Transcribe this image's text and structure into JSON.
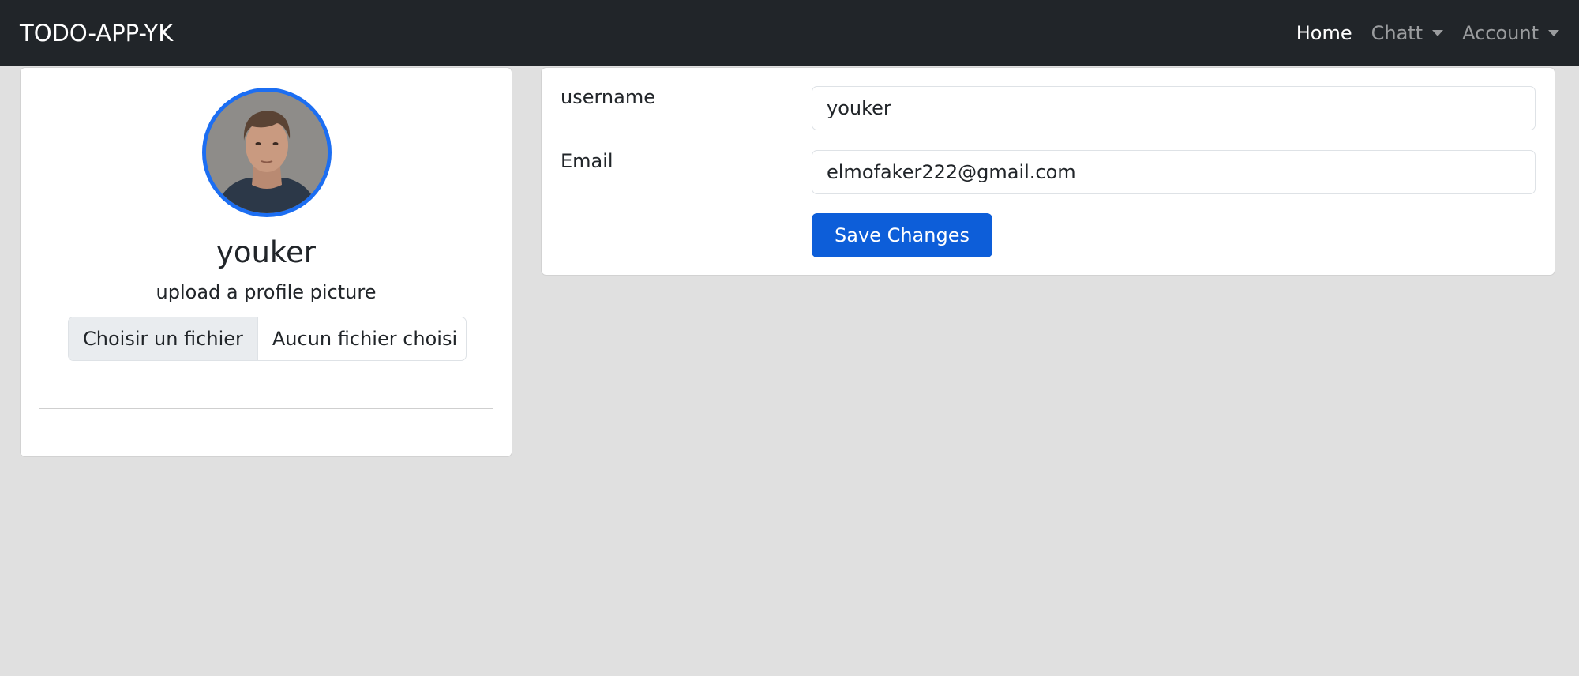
{
  "navbar": {
    "brand": "TODO-APP-YK",
    "links": [
      {
        "label": "Home",
        "active": true,
        "dropdown": false
      },
      {
        "label": "Chatt",
        "active": false,
        "dropdown": true
      },
      {
        "label": "Account",
        "active": false,
        "dropdown": true
      }
    ]
  },
  "profile": {
    "avatar_icon": "profile-photo",
    "name": "youker",
    "upload_label": "upload a profile picture",
    "file_button": "Choisir un fichier",
    "file_status": "Aucun fichier choisi"
  },
  "form": {
    "username_label": "username",
    "username_value": "youker",
    "email_label": "Email",
    "email_value": "elmofaker222@gmail.com",
    "save_label": "Save Changes"
  },
  "colors": {
    "navbar_bg": "#212529",
    "page_bg": "#e0e0e0",
    "primary": "#0d5ed9",
    "avatar_ring": "#1c6ef2"
  }
}
